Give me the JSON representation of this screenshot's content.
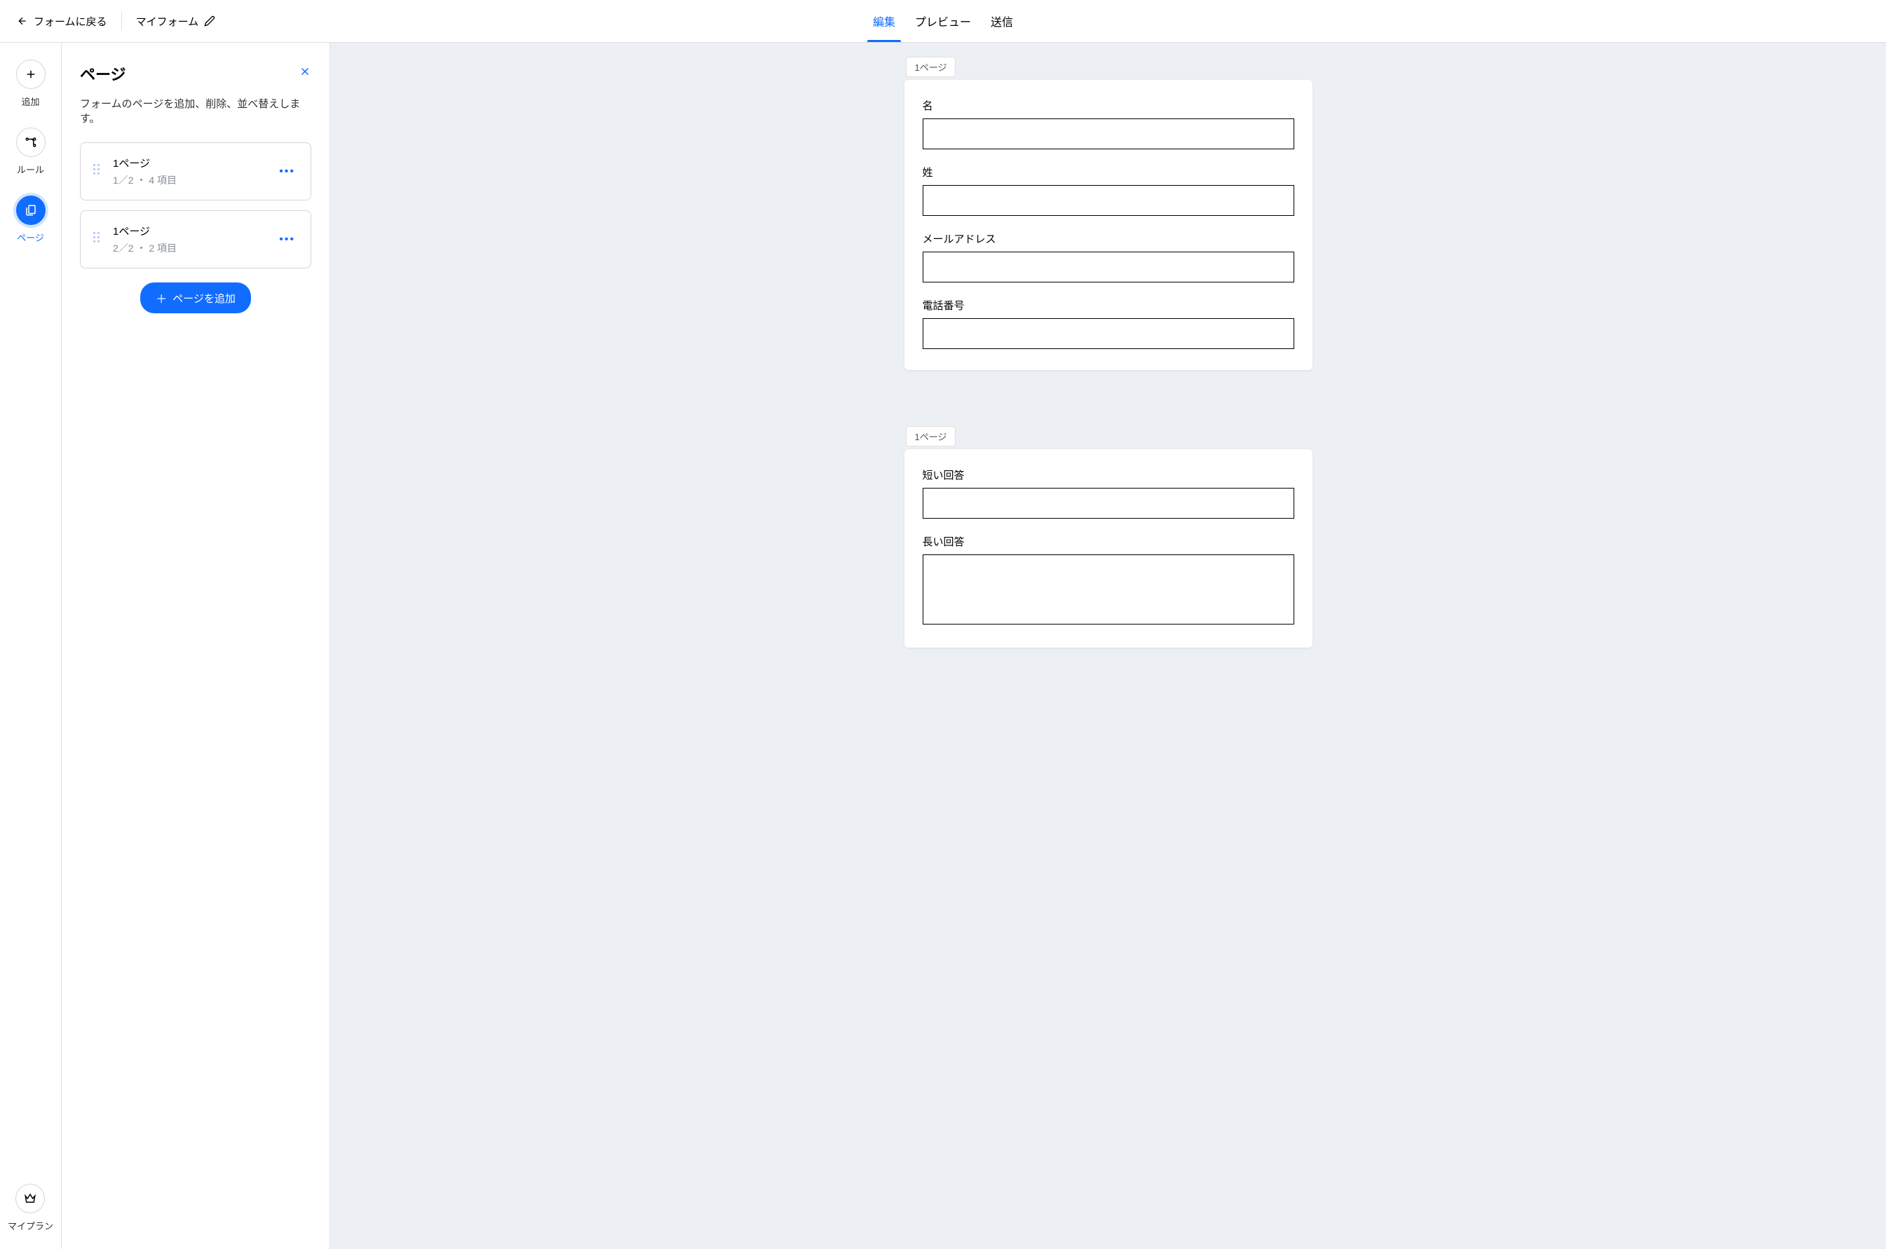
{
  "header": {
    "back_label": "フォームに戻る",
    "form_title": "マイフォーム",
    "tabs": {
      "edit": "編集",
      "preview": "プレビュー",
      "send": "送信"
    }
  },
  "rail": {
    "add": "追加",
    "rules": "ルール",
    "pages": "ページ",
    "myplan": "マイプラン"
  },
  "sidebar": {
    "title": "ページ",
    "description": "フォームのページを追加、削除、並べ替えします。",
    "cards": [
      {
        "title": "1ページ",
        "meta": "1／2 ・ 4 項目"
      },
      {
        "title": "1ページ",
        "meta": "2／2 ・ 2 項目"
      }
    ],
    "add_button": "ページを追加"
  },
  "canvas": {
    "sections": [
      {
        "label": "1ページ",
        "fields": [
          {
            "label": "名",
            "type": "text"
          },
          {
            "label": "姓",
            "type": "text"
          },
          {
            "label": "メールアドレス",
            "type": "text"
          },
          {
            "label": "電話番号",
            "type": "text"
          }
        ]
      },
      {
        "label": "1ページ",
        "fields": [
          {
            "label": "短い回答",
            "type": "text"
          },
          {
            "label": "長い回答",
            "type": "textarea"
          }
        ]
      }
    ]
  }
}
